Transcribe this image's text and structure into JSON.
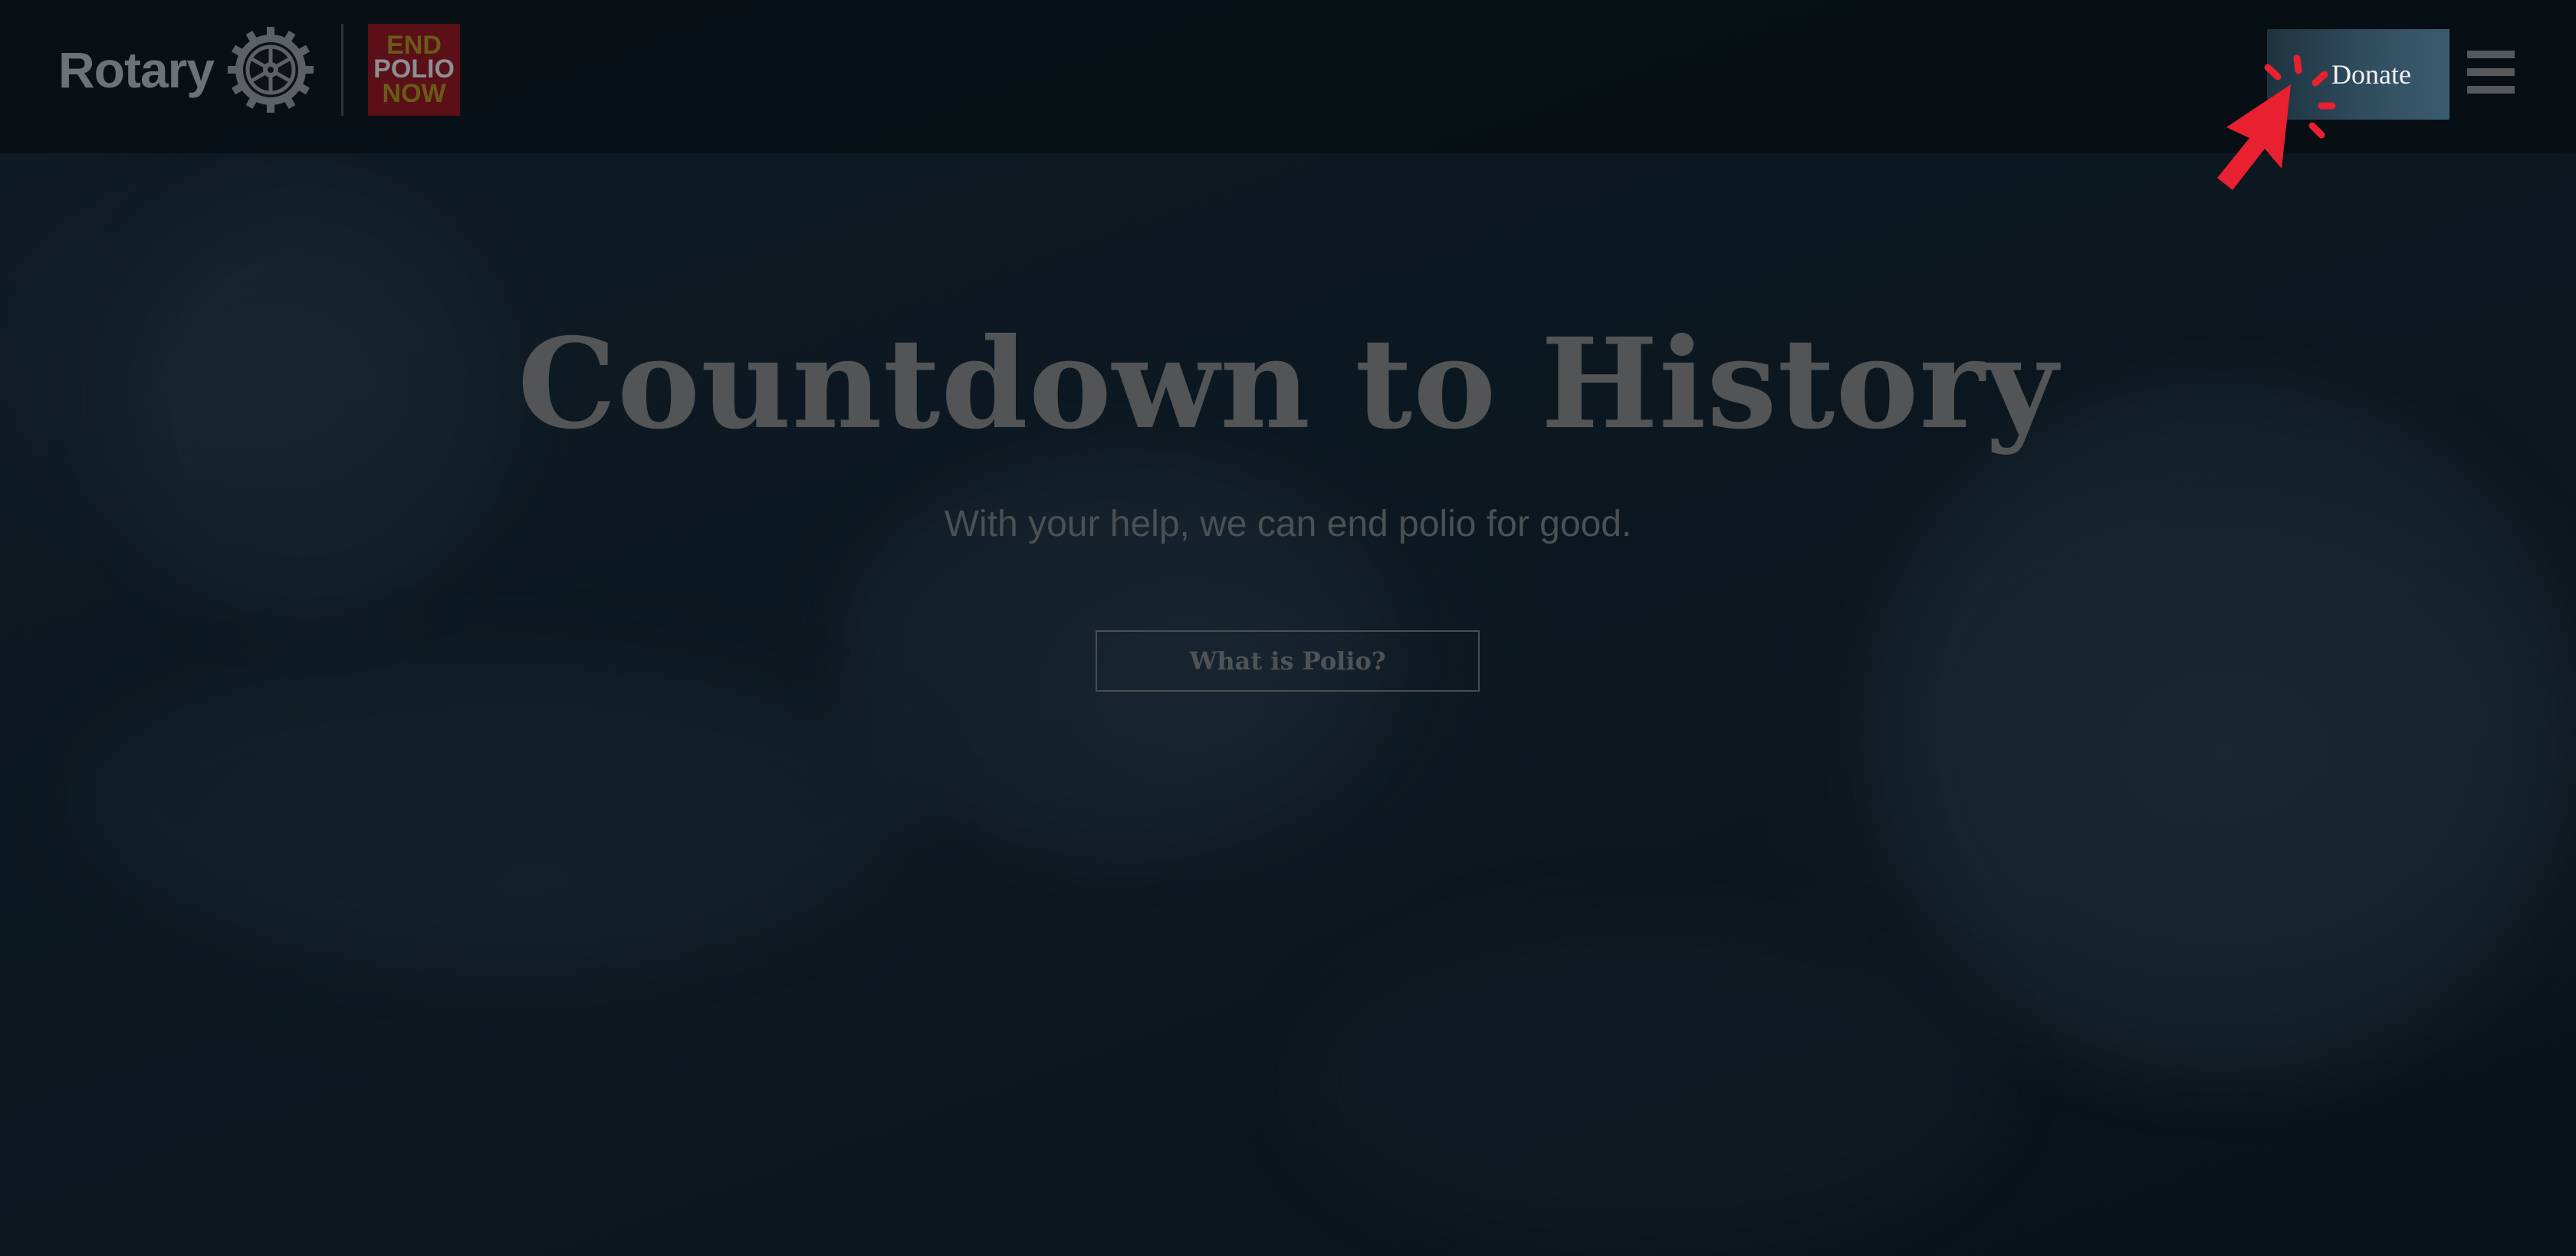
{
  "header": {
    "brand_text": "Rotary",
    "badge_lines": [
      "END",
      "POLIO",
      "NOW"
    ],
    "donate_label": "Donate",
    "menu_icon": "hamburger-menu-icon"
  },
  "hero": {
    "title": "Countdown to History",
    "subtitle": "With your help, we can end polio for good.",
    "cta_label": "What is Polio?"
  },
  "colors": {
    "cursor_red": "#e8202f",
    "donate_bg": "#3b5c70",
    "badge_bg": "#5a1016"
  },
  "icons": {
    "gear": "rotary-wheel-icon",
    "cursor": "click-cursor-icon"
  }
}
